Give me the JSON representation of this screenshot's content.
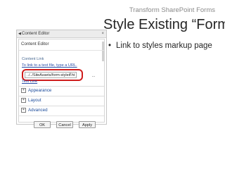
{
  "deck": {
    "header": "Transform SharePoint Forms"
  },
  "slide": {
    "title": "Style Existing “Form”",
    "bullets": [
      "Link to styles markup page"
    ]
  },
  "content_editor": {
    "panel_title": "Content Editor",
    "close_glyph": "×",
    "section_title": "Content Editor",
    "content_link_label": "Content Link",
    "hint_link": "To link to a text file, type a URL.",
    "link_value": "../../SiteAssets/form-styles.ht",
    "browse_label": "...",
    "test_link": "Test Link",
    "sections": [
      {
        "label": "Appearance",
        "toggle": "+"
      },
      {
        "label": "Layout",
        "toggle": "+"
      },
      {
        "label": "Advanced",
        "toggle": "+"
      }
    ],
    "buttons": {
      "ok": "OK",
      "cancel": "Cancel",
      "apply": "Apply"
    },
    "highlight_color": "#cf1d1d"
  }
}
